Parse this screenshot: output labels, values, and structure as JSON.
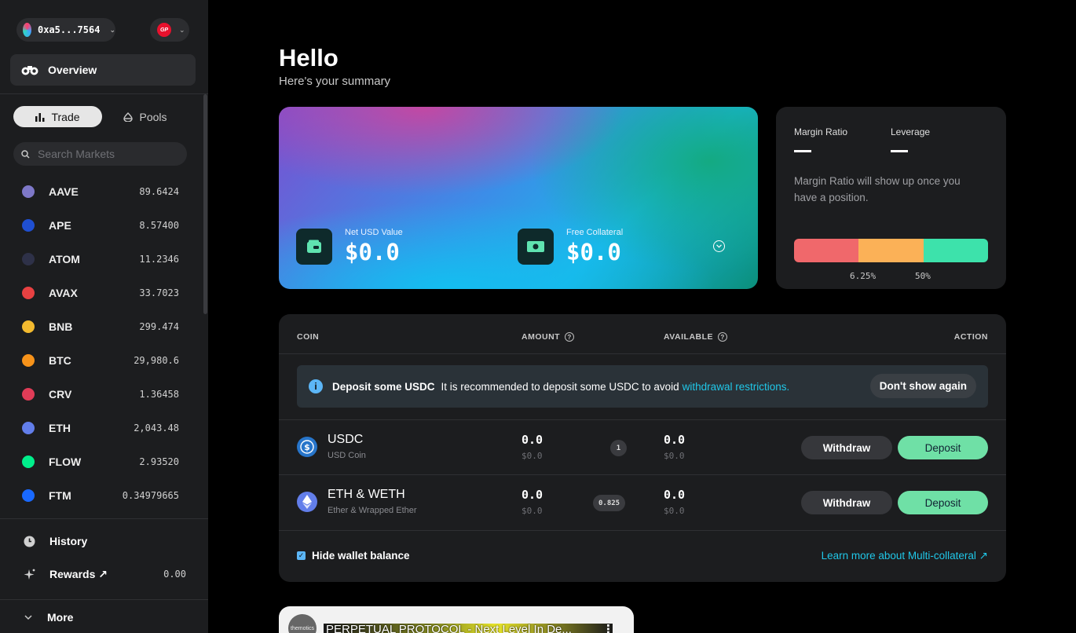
{
  "sidebar": {
    "wallet_address": "0xa5...7564",
    "wallet_caret": "⌄",
    "gp_logo": "GP",
    "gp_caret": "⌄",
    "overview_label": "Overview",
    "tabs": {
      "trade": "Trade",
      "pools": "Pools"
    },
    "search_placeholder": "Search Markets",
    "markets": [
      {
        "symbol": "AAVE",
        "price": "89.6424",
        "color": "#7e78c8"
      },
      {
        "symbol": "APE",
        "price": "8.57400",
        "color": "#1f4fd1"
      },
      {
        "symbol": "ATOM",
        "price": "11.2346",
        "color": "#2e3148"
      },
      {
        "symbol": "AVAX",
        "price": "33.7023",
        "color": "#e84142"
      },
      {
        "symbol": "BNB",
        "price": "299.474",
        "color": "#f3ba2f"
      },
      {
        "symbol": "BTC",
        "price": "29,980.6",
        "color": "#f7931a"
      },
      {
        "symbol": "CRV",
        "price": "1.36458",
        "color": "#e03c57"
      },
      {
        "symbol": "ETH",
        "price": "2,043.48",
        "color": "#627eea"
      },
      {
        "symbol": "FLOW",
        "price": "2.93520",
        "color": "#00ef8b"
      },
      {
        "symbol": "FTM",
        "price": "0.34979665",
        "color": "#1969ff"
      }
    ],
    "history_label": "History",
    "rewards_label": "Rewards ↗",
    "rewards_value": "0.00",
    "more_label": "More"
  },
  "header": {
    "title": "Hello",
    "subtitle": "Here's your summary"
  },
  "summary": {
    "net_usd_label": "Net USD Value",
    "net_usd_value": "$0.0",
    "free_collateral_label": "Free Collateral",
    "free_collateral_value": "$0.0"
  },
  "margin": {
    "margin_ratio_label": "Margin Ratio",
    "leverage_label": "Leverage",
    "note": "Margin Ratio will show up once you have a position.",
    "tick_1": "6.25%",
    "tick_2": "50%",
    "bar_colors": [
      "#f0686b",
      "#fbb157",
      "#3de2ab"
    ]
  },
  "collateral_table": {
    "headers": {
      "coin": "COIN",
      "amount": "AMOUNT",
      "available": "AVAILABLE",
      "action": "ACTION"
    },
    "help_glyph": "?",
    "notice": {
      "title": "Deposit some USDC",
      "text": "It is recommended to deposit some USDC to avoid",
      "link": "withdrawal restrictions.",
      "dismiss": "Don't show again"
    },
    "rows": [
      {
        "name": "USDC",
        "sub": "USD Coin",
        "amount": "0.0",
        "amount_usd": "$0.0",
        "weight": "1",
        "available": "0.0",
        "available_usd": "$0.0",
        "withdraw": "Withdraw",
        "deposit": "Deposit"
      },
      {
        "name": "ETH & WETH",
        "sub": "Ether & Wrapped Ether",
        "amount": "0.0",
        "amount_usd": "$0.0",
        "weight": "0.825",
        "available": "0.0",
        "available_usd": "$0.0",
        "withdraw": "Withdraw",
        "deposit": "Deposit"
      }
    ],
    "hide_wallet_label": "Hide wallet balance",
    "learn_more": "Learn more about Multi-collateral ↗"
  },
  "video": {
    "channel": "themotics",
    "title": "PERPETUAL PROTOCOL - Next Level In De..."
  }
}
